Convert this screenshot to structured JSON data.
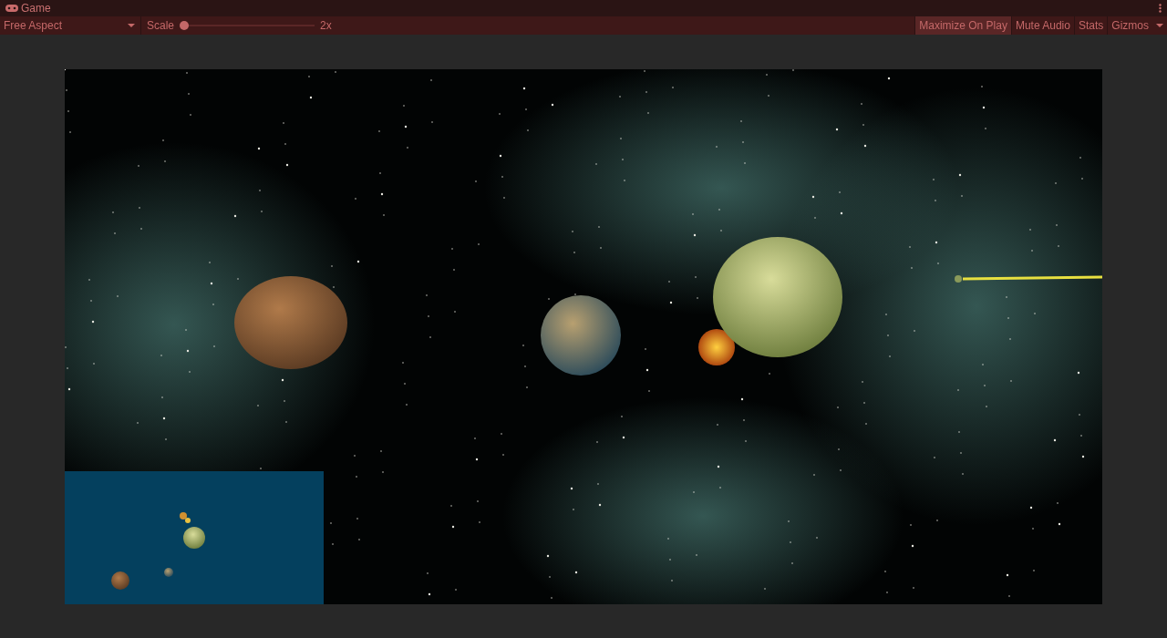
{
  "window": {
    "title": "Game"
  },
  "toolbar": {
    "aspect_dropdown": "Free Aspect",
    "scale": {
      "label": "Scale",
      "level": 0,
      "reading": "2x"
    },
    "toggles": [
      {
        "label": "Maximize On Play",
        "on": true
      },
      {
        "label": "Mute Audio",
        "on": false
      },
      {
        "label": "Stats",
        "on": false
      },
      {
        "label": "Gizmos",
        "on": false
      }
    ]
  }
}
